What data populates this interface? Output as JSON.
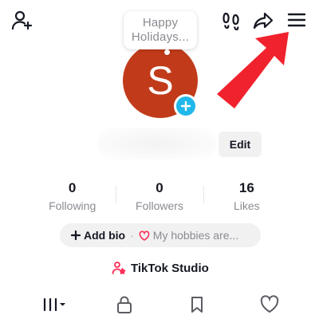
{
  "header": {
    "add_friend_icon": "person-plus-icon",
    "footprint_icon": "footprints-icon",
    "share_icon": "share-arrow-icon",
    "menu_icon": "hamburger-menu-icon"
  },
  "profile": {
    "note_bubble": [
      "Happy",
      "Holidays..."
    ],
    "avatar_initial": "S",
    "avatar_color": "#c13b1a",
    "avatar_add_color": "#20b8ea",
    "edit_label": "Edit"
  },
  "stats": [
    {
      "value": "0",
      "label": "Following"
    },
    {
      "value": "0",
      "label": "Followers"
    },
    {
      "value": "16",
      "label": "Likes"
    }
  ],
  "bio": {
    "add_label": "Add bio",
    "hint": "My hobbies are..."
  },
  "studio": {
    "label": "TikTok Studio",
    "accent": "#fe2c55"
  },
  "tabs": [
    {
      "name": "videos-grid",
      "icon": "grid-icon"
    },
    {
      "name": "private",
      "icon": "lock-icon"
    },
    {
      "name": "favorites",
      "icon": "bookmark-icon"
    },
    {
      "name": "liked",
      "icon": "heart-icon"
    }
  ],
  "annotation": {
    "arrow_color": "#f0222d"
  }
}
